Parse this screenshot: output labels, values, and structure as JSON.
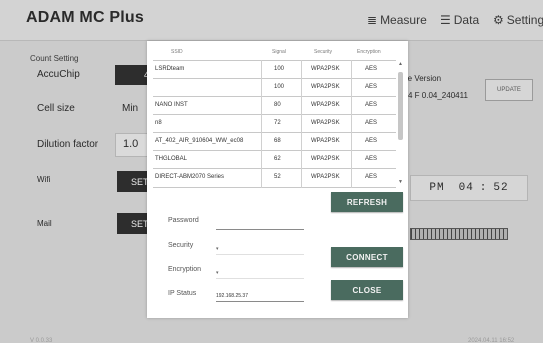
{
  "app": {
    "title": "ADAM MC Plus",
    "nav": {
      "measure": "Measure",
      "data": "Data",
      "setting": "Setting"
    }
  },
  "settings": {
    "count_setting_title": "Count Setting",
    "accuchip_label": "AccuChip",
    "accuchip_value": "4",
    "cell_size_label": "Cell size",
    "cell_size_value": "Min",
    "dilution_label": "Dilution factor",
    "dilution_value": "1.0",
    "wifi_label": "Wifi",
    "wifi_button": "SET",
    "mail_label": "Mail",
    "mail_button": "SET"
  },
  "firmware": {
    "label": "re Version",
    "value": "4 F 0.04_240411",
    "update_button": "UPDATE"
  },
  "clock": {
    "ampm": "PM",
    "hour": "04",
    "minute": "52"
  },
  "footer": {
    "left": "V 0.0.33",
    "right": "2024.04.11 16:52"
  },
  "wifi_dialog": {
    "columns": [
      "SSID",
      "Signal",
      "Security",
      "Encryption"
    ],
    "networks": [
      {
        "ssid": "LSRDteam",
        "signal": "100",
        "security": "WPA2PSK",
        "encryption": "AES"
      },
      {
        "ssid": "",
        "signal": "100",
        "security": "WPA2PSK",
        "encryption": "AES"
      },
      {
        "ssid": "NANO INST",
        "signal": "80",
        "security": "WPA2PSK",
        "encryption": "AES"
      },
      {
        "ssid": "n8",
        "signal": "72",
        "security": "WPA2PSK",
        "encryption": "AES"
      },
      {
        "ssid": "AT_402_AIR_910604_WW_ec08",
        "signal": "68",
        "security": "WPA2PSK",
        "encryption": "AES"
      },
      {
        "ssid": "THGLOBAL",
        "signal": "62",
        "security": "WPA2PSK",
        "encryption": "AES"
      },
      {
        "ssid": "DIRECT-ABM2070 Series",
        "signal": "52",
        "security": "WPA2PSK",
        "encryption": "AES"
      }
    ],
    "refresh_button": "REFRESH",
    "password_label": "Password",
    "password_value": "",
    "security_label": "Security",
    "security_value": "",
    "encryption_label": "Encryption",
    "encryption_value": "",
    "ip_label": "IP Status",
    "ip_value": "192.168.25.37",
    "connect_button": "CONNECT",
    "close_button": "CLOSE"
  }
}
